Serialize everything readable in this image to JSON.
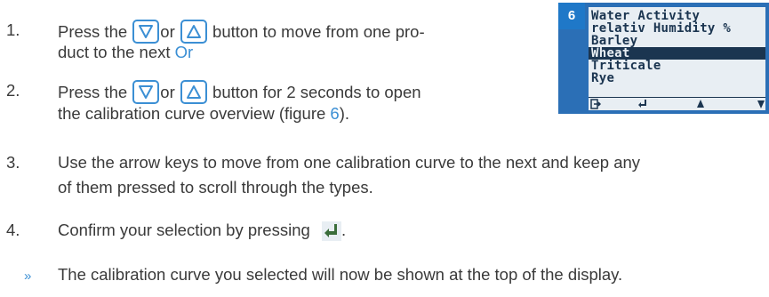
{
  "steps": [
    {
      "num": "1.",
      "text_a": "Press the",
      "or": "or",
      "text_b": "button to move from one pro-",
      "line2a": "duct to the next",
      "line2_or": "Or"
    },
    {
      "num": "2.",
      "text_a": "Press the",
      "or": "or",
      "text_b": "button for 2 seconds to open",
      "line2a": "the calibration curve overview (figure",
      "fig_ref": "6",
      "line2_end": ")."
    },
    {
      "num": "3.",
      "line1": "Use the arrow keys to move from one calibration curve to the next and keep any",
      "line2": "of them pressed to scroll through the types."
    },
    {
      "num": "4.",
      "text": "Confirm your selection by pressing",
      "end": "."
    },
    {
      "bullet": "»",
      "text": "The calibration curve you selected will now be shown at the top of the display."
    }
  ],
  "figure": {
    "number": "6",
    "lines": [
      "Water Activity",
      "relativ Humidity %",
      "Barley",
      "Wheat",
      "Triticale",
      "Rye"
    ],
    "selected_index": 3,
    "bar_icons": [
      "exit-icon",
      "enter-icon",
      "up-arrow-icon",
      "down-arrow-icon"
    ]
  },
  "colors": {
    "accent": "#3b8fd4",
    "figure_blue": "#1f78c8",
    "lcd_bg": "#e8eef3",
    "lcd_fg": "#1b3550"
  }
}
